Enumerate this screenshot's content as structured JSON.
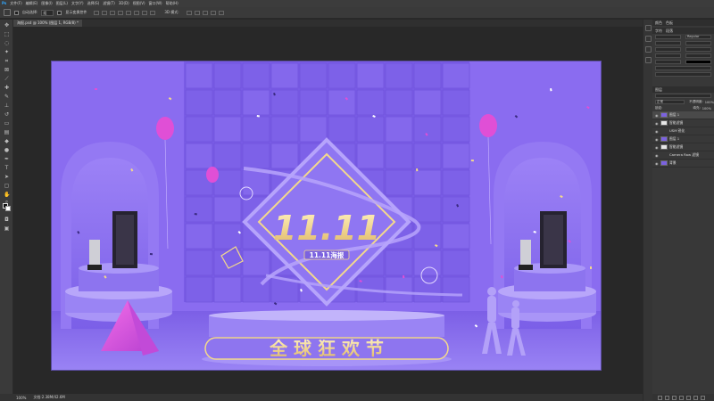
{
  "menu": [
    "文件(F)",
    "编辑(E)",
    "图像(I)",
    "图层(L)",
    "文字(Y)",
    "选择(S)",
    "滤镜(T)",
    "3D(D)",
    "视图(V)",
    "窗口(W)",
    "帮助(H)"
  ],
  "options": {
    "auto_select_label": "自动选择:",
    "auto_select_value": "组",
    "transform_label": "显示变换控件",
    "mode_3d_label": "3D 模式:"
  },
  "tab": {
    "title": "海报.psd @ 100% (图层 1, RGB/8) *"
  },
  "status": {
    "zoom": "100%",
    "doc": "文档:2.38M/42.6M"
  },
  "panels": {
    "tabs": [
      "颜色",
      "色板"
    ],
    "character_tabs": [
      "字符",
      "段落"
    ],
    "font_style": "Regular",
    "layers_tab": "图层",
    "blend_mode": "正常",
    "opacity_label": "不透明度:",
    "opacity_value": "100%",
    "lock_label": "锁定:",
    "fill_label": "填充:",
    "fill_value": "100%",
    "layers": [
      {
        "name": "图层 1",
        "selected": true
      },
      {
        "name": "智能滤镜",
        "selected": false
      },
      {
        "name": "USM 锐化",
        "selected": false
      },
      {
        "name": "图层 1",
        "selected": false
      },
      {
        "name": "智能滤镜",
        "selected": false
      },
      {
        "name": "Camera Raw 滤镜",
        "selected": false
      },
      {
        "name": "背景",
        "selected": false
      }
    ]
  },
  "poster": {
    "headline": "11.11",
    "badge": "11.11海报",
    "slogan": "全 球 狂 欢 节"
  },
  "colors": {
    "poster_bg": "#8a6cf0",
    "gold": "#f3d98c",
    "balloon": "#e04fd6",
    "canvas_gray": "#282828"
  }
}
